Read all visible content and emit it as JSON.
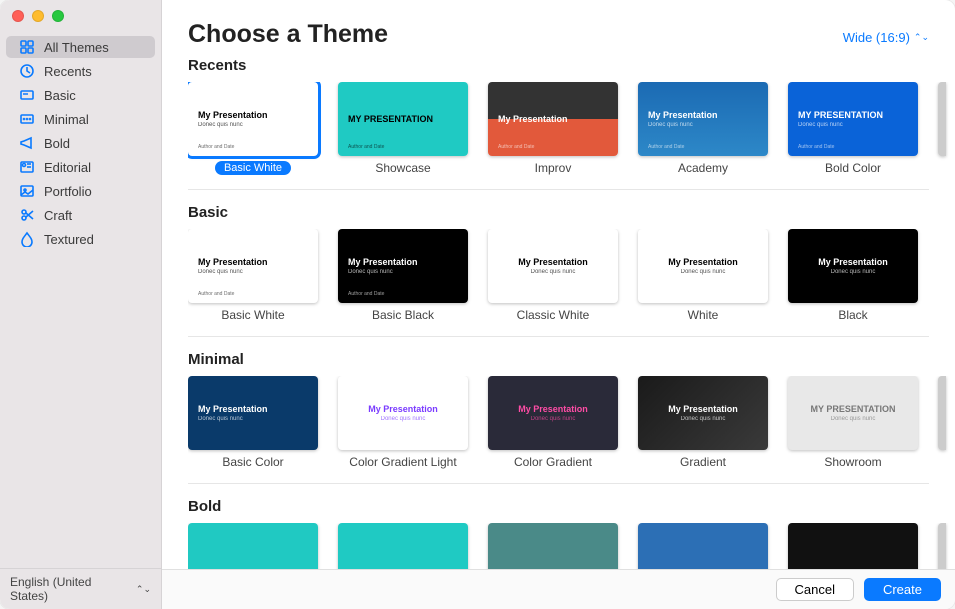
{
  "header": {
    "title": "Choose a Theme",
    "aspect_label": "Wide (16:9)"
  },
  "sidebar": {
    "items": [
      {
        "label": "All Themes",
        "icon": "grid"
      },
      {
        "label": "Recents",
        "icon": "clock"
      },
      {
        "label": "Basic",
        "icon": "card"
      },
      {
        "label": "Minimal",
        "icon": "text"
      },
      {
        "label": "Bold",
        "icon": "megaphone"
      },
      {
        "label": "Editorial",
        "icon": "badge"
      },
      {
        "label": "Portfolio",
        "icon": "photo"
      },
      {
        "label": "Craft",
        "icon": "scissors"
      },
      {
        "label": "Textured",
        "icon": "drop"
      }
    ],
    "selected_index": 0
  },
  "language": {
    "label": "English (United States)"
  },
  "sections": [
    {
      "title": "Recents",
      "themes": [
        {
          "label": "Basic White",
          "thumb_title": "My Presentation",
          "thumb_sub": "Donec quis nunc",
          "scheme": "bg-white",
          "selected": true
        },
        {
          "label": "Showcase",
          "thumb_title": "MY PRESENTATION",
          "thumb_sub": "",
          "scheme": "bg-teal"
        },
        {
          "label": "Improv",
          "thumb_title": "My Presentation",
          "thumb_sub": "",
          "scheme": "bg-improv"
        },
        {
          "label": "Academy",
          "thumb_title": "My Presentation",
          "thumb_sub": "Donec quis nunc",
          "scheme": "bg-academy"
        },
        {
          "label": "Bold Color",
          "thumb_title": "MY PRESENTATION",
          "thumb_sub": "Donec quis nunc",
          "scheme": "bg-boldcolor"
        }
      ]
    },
    {
      "title": "Basic",
      "themes": [
        {
          "label": "Basic White",
          "thumb_title": "My Presentation",
          "thumb_sub": "Donec quis nunc",
          "scheme": "bg-white"
        },
        {
          "label": "Basic Black",
          "thumb_title": "My Presentation",
          "thumb_sub": "Donec quis nunc",
          "scheme": "bg-black"
        },
        {
          "label": "Classic White",
          "thumb_title": "My Presentation",
          "thumb_sub": "Donec quis nunc",
          "scheme": "bg-white",
          "center": true
        },
        {
          "label": "White",
          "thumb_title": "My Presentation",
          "thumb_sub": "Donec quis nunc",
          "scheme": "bg-white",
          "center": true
        },
        {
          "label": "Black",
          "thumb_title": "My Presentation",
          "thumb_sub": "Donec quis nunc",
          "scheme": "bg-black",
          "center": true
        }
      ]
    },
    {
      "title": "Minimal",
      "themes": [
        {
          "label": "Basic Color",
          "thumb_title": "My Presentation",
          "thumb_sub": "Donec quis nunc",
          "scheme": "bg-navy"
        },
        {
          "label": "Color Gradient Light",
          "thumb_title": "My Presentation",
          "thumb_sub": "Donec quis nunc",
          "scheme": "bg-cgl",
          "center": true
        },
        {
          "label": "Color Gradient",
          "thumb_title": "My Presentation",
          "thumb_sub": "Donec quis nunc",
          "scheme": "bg-cg",
          "center": true
        },
        {
          "label": "Gradient",
          "thumb_title": "My Presentation",
          "thumb_sub": "Donec quis nunc",
          "scheme": "bg-grad",
          "center": true
        },
        {
          "label": "Showroom",
          "thumb_title": "MY PRESENTATION",
          "thumb_sub": "Donec quis nunc",
          "scheme": "bg-show",
          "center": true
        }
      ]
    },
    {
      "title": "Bold",
      "themes": [
        {
          "label": "",
          "scheme": "bg-bold1"
        },
        {
          "label": "",
          "scheme": "bg-bold2"
        },
        {
          "label": "",
          "scheme": "bg-bold3"
        },
        {
          "label": "",
          "scheme": "bg-bold4"
        },
        {
          "label": "",
          "scheme": "bg-bold5"
        }
      ]
    }
  ],
  "footer": {
    "cancel": "Cancel",
    "create": "Create"
  }
}
